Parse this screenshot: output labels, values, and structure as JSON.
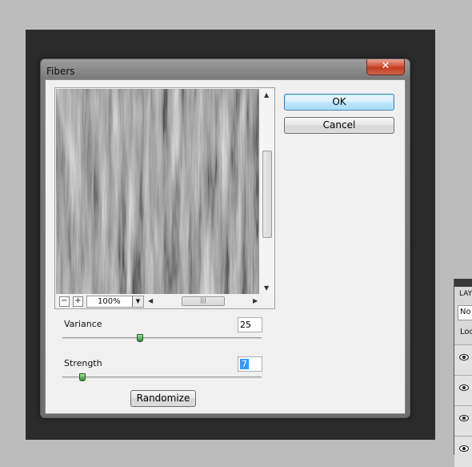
{
  "dialog": {
    "title": "Fibers",
    "close_glyph": "✕",
    "ok_label": "OK",
    "cancel_label": "Cancel",
    "randomize_label": "Randomize"
  },
  "preview": {
    "zoom_out_label": "−",
    "zoom_in_label": "+",
    "zoom_value": "100%"
  },
  "params": {
    "variance_label": "Variance",
    "variance_value": "25",
    "variance_level": 0.39,
    "strength_label": "Strength",
    "strength_value": "7",
    "strength_level": 0.1
  },
  "layers_panel": {
    "tab_label": "LAY",
    "blend_mode": "No",
    "lock_label": "Loc"
  },
  "colors": {
    "canvas": "#2b2b2b",
    "close_button": "#c13c20",
    "default_button_border": "#3c7fb1",
    "slider_thumb": "#2f8a2f"
  }
}
